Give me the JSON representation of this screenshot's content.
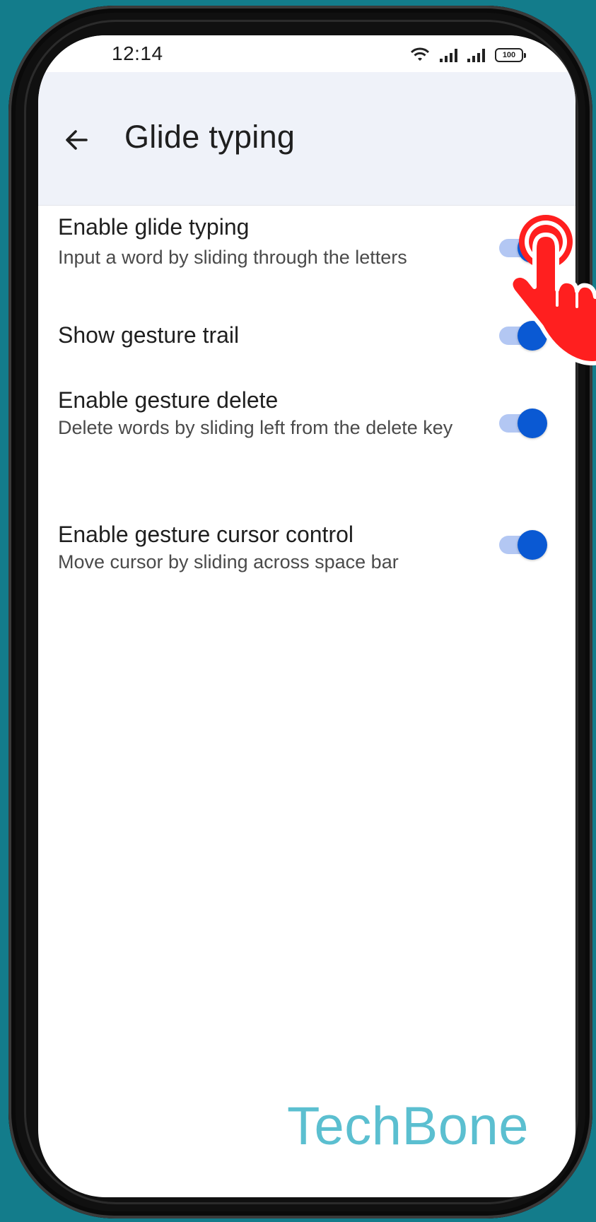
{
  "status_bar": {
    "time": "12:14",
    "battery": "100",
    "icons": [
      "wifi-icon",
      "signal-icon",
      "signal-icon",
      "battery-icon"
    ]
  },
  "app_bar": {
    "back_icon": "arrow-left-icon",
    "title": "Glide typing"
  },
  "settings": [
    {
      "title": "Enable glide typing",
      "summary": "Input a word by sliding through the letters",
      "enabled": true
    },
    {
      "title": "Show gesture trail",
      "summary": "",
      "enabled": true
    },
    {
      "title": "Enable gesture delete",
      "summary": "Delete words by sliding left from the delete key",
      "enabled": true
    },
    {
      "title": "Enable gesture cursor control",
      "summary": "Move cursor by sliding across space bar",
      "enabled": true
    }
  ],
  "overlay": {
    "tap_indicator_icon": "pointing-hand-icon",
    "watermark": "TechBone"
  },
  "colors": {
    "background": "#137c8b",
    "app_bar": "#eff2f9",
    "toggle_thumb": "#0a59d3",
    "toggle_track": "#b3c7f3",
    "tap_hand": "#ff1f1f",
    "watermark": "#5bbfd0"
  }
}
